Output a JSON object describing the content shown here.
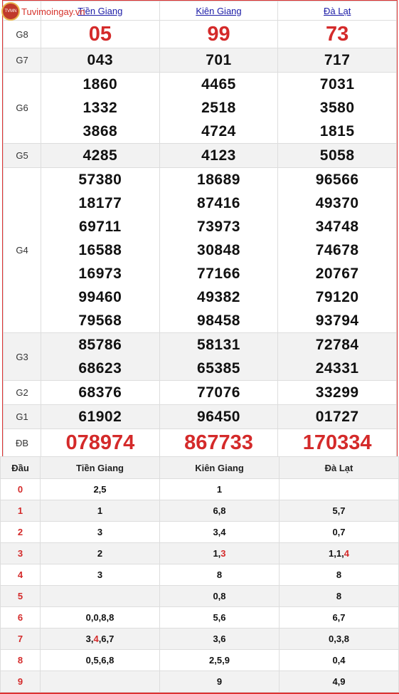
{
  "logo": {
    "text": "Tuvimoingay.vn"
  },
  "provinces": [
    "Tiền Giang",
    "Kiên Giang",
    "Đà Lạt"
  ],
  "prizes": [
    {
      "label": "G8",
      "big": true,
      "cols": [
        [
          "05"
        ],
        [
          "99"
        ],
        [
          "73"
        ]
      ]
    },
    {
      "label": "G7",
      "cols": [
        [
          "043"
        ],
        [
          "701"
        ],
        [
          "717"
        ]
      ]
    },
    {
      "label": "G6",
      "cols": [
        [
          "1860",
          "1332",
          "3868"
        ],
        [
          "4465",
          "2518",
          "4724"
        ],
        [
          "7031",
          "3580",
          "1815"
        ]
      ]
    },
    {
      "label": "G5",
      "cols": [
        [
          "4285"
        ],
        [
          "4123"
        ],
        [
          "5058"
        ]
      ]
    },
    {
      "label": "G4",
      "cols": [
        [
          "57380",
          "18177",
          "69711",
          "16588",
          "16973",
          "99460",
          "79568"
        ],
        [
          "18689",
          "87416",
          "73973",
          "30848",
          "77166",
          "49382",
          "98458"
        ],
        [
          "96566",
          "49370",
          "34748",
          "74678",
          "20767",
          "79120",
          "93794"
        ]
      ]
    },
    {
      "label": "G3",
      "cols": [
        [
          "85786",
          "68623"
        ],
        [
          "58131",
          "65385"
        ],
        [
          "72784",
          "24331"
        ]
      ]
    },
    {
      "label": "G2",
      "cols": [
        [
          "68376"
        ],
        [
          "77076"
        ],
        [
          "33299"
        ]
      ]
    },
    {
      "label": "G1",
      "cols": [
        [
          "61902"
        ],
        [
          "96450"
        ],
        [
          "01727"
        ]
      ]
    },
    {
      "label": "ĐB",
      "big": true,
      "cols": [
        [
          "078974"
        ],
        [
          "867733"
        ],
        [
          "170334"
        ]
      ]
    }
  ],
  "heads": {
    "header": [
      "Đầu",
      "Tiền Giang",
      "Kiên Giang",
      "Đà Lạt"
    ],
    "rows": [
      {
        "d": "0",
        "v": [
          [
            {
              "t": "2,5"
            }
          ],
          [
            {
              "t": "1"
            }
          ],
          []
        ]
      },
      {
        "d": "1",
        "v": [
          [
            {
              "t": "1"
            }
          ],
          [
            {
              "t": "6,8"
            }
          ],
          [
            {
              "t": "5,7"
            }
          ]
        ]
      },
      {
        "d": "2",
        "v": [
          [
            {
              "t": "3"
            }
          ],
          [
            {
              "t": "3,4"
            }
          ],
          [
            {
              "t": "0,7"
            }
          ]
        ]
      },
      {
        "d": "3",
        "v": [
          [
            {
              "t": "2"
            }
          ],
          [
            {
              "t": "1,"
            },
            {
              "t": "3",
              "r": true
            }
          ],
          [
            {
              "t": "1,1,"
            },
            {
              "t": "4",
              "r": true
            }
          ]
        ]
      },
      {
        "d": "4",
        "v": [
          [
            {
              "t": "3"
            }
          ],
          [
            {
              "t": "8"
            }
          ],
          [
            {
              "t": "8"
            }
          ]
        ]
      },
      {
        "d": "5",
        "v": [
          [],
          [
            {
              "t": "0,8"
            }
          ],
          [
            {
              "t": "8"
            }
          ]
        ]
      },
      {
        "d": "6",
        "v": [
          [
            {
              "t": "0,0,8,8"
            }
          ],
          [
            {
              "t": "5,6"
            }
          ],
          [
            {
              "t": "6,7"
            }
          ]
        ]
      },
      {
        "d": "7",
        "v": [
          [
            {
              "t": "3,"
            },
            {
              "t": "4",
              "r": true
            },
            {
              "t": ",6,7"
            }
          ],
          [
            {
              "t": "3,6"
            }
          ],
          [
            {
              "t": "0,3,8"
            }
          ]
        ]
      },
      {
        "d": "8",
        "v": [
          [
            {
              "t": "0,5,6,8"
            }
          ],
          [
            {
              "t": "2,5,9"
            }
          ],
          [
            {
              "t": "0,4"
            }
          ]
        ]
      },
      {
        "d": "9",
        "v": [
          [],
          [
            {
              "t": "9"
            }
          ],
          [
            {
              "t": "4,9"
            }
          ]
        ]
      }
    ]
  }
}
